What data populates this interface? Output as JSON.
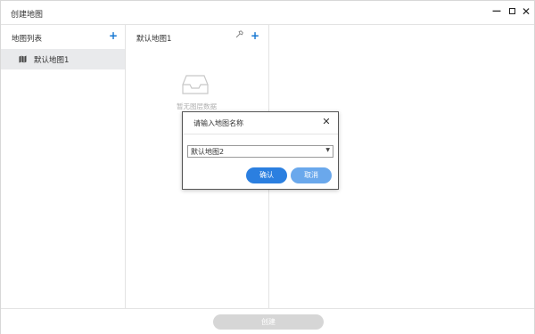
{
  "window": {
    "title": "创建地图",
    "controls": [
      "minimize-icon",
      "maximize-icon",
      "close-icon"
    ]
  },
  "left_panel": {
    "title": "地图列表",
    "add_icon": "plus-icon",
    "items": [
      {
        "label": "默认地图1",
        "icon": "map-icon",
        "selected": true
      }
    ]
  },
  "middle_panel": {
    "title": "默认地图1",
    "settings_icon": "wrench-icon",
    "add_icon": "plus-icon",
    "empty_text": "暂无图层数据"
  },
  "footer": {
    "create_label": "创建"
  },
  "dialog": {
    "title": "请输入地图名称",
    "select_value": "默认地图2",
    "confirm_label": "确认",
    "cancel_label": "取消"
  },
  "colors": {
    "accent": "#2b7fe0",
    "accent_light": "#6aa8ec",
    "selected_bg": "#e9eaec",
    "disabled": "#d6d6d6"
  }
}
